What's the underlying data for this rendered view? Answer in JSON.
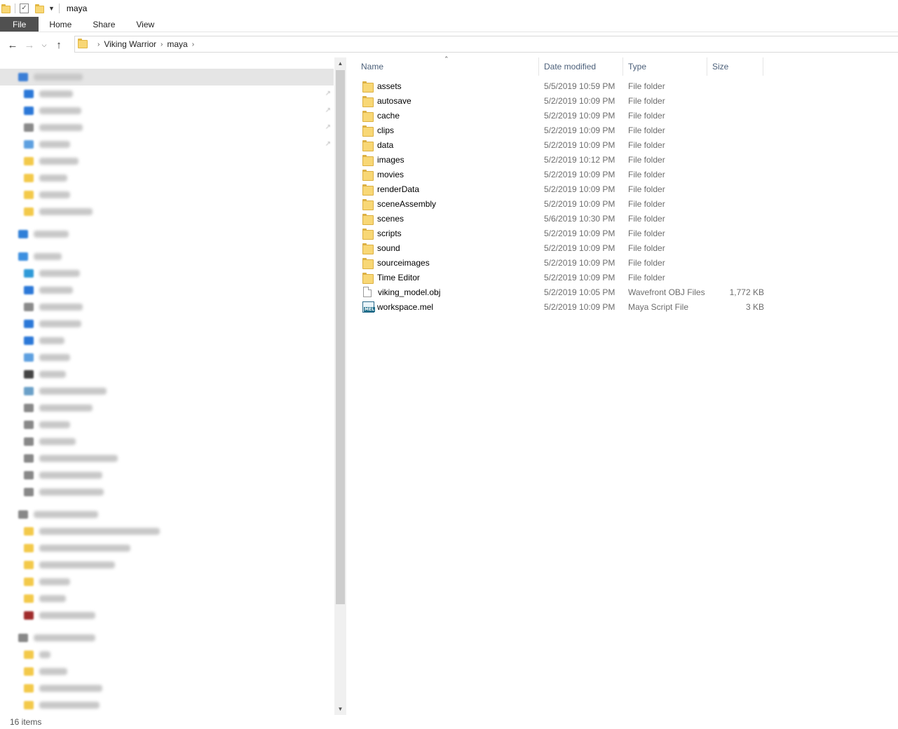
{
  "window": {
    "title": "maya"
  },
  "ribbon": {
    "tabs": [
      "File",
      "Home",
      "Share",
      "View"
    ]
  },
  "address": {
    "crumbs": [
      "Viking Warrior",
      "maya"
    ]
  },
  "nav_pane": {
    "items": [
      {
        "icon": "star-icon",
        "color": "#3a7dd6",
        "width": 70,
        "selected": true,
        "indent": 0
      },
      {
        "icon": "desktop-icon",
        "color": "#2b78d8",
        "width": 48,
        "pinned": true,
        "indent": 1
      },
      {
        "icon": "download-icon",
        "color": "#2b78d8",
        "width": 60,
        "pinned": true,
        "indent": 1
      },
      {
        "icon": "document-icon",
        "color": "#8a8a8a",
        "width": 62,
        "pinned": true,
        "indent": 1
      },
      {
        "icon": "pictures-icon",
        "color": "#5ea0e0",
        "width": 44,
        "pinned": true,
        "indent": 1
      },
      {
        "icon": "folder-icon",
        "color": "#f3c94a",
        "width": 56,
        "indent": 1
      },
      {
        "icon": "folder-icon",
        "color": "#f3c94a",
        "width": 40,
        "indent": 1
      },
      {
        "icon": "folder-icon",
        "color": "#f3c94a",
        "width": 44,
        "indent": 1
      },
      {
        "icon": "folder-icon",
        "color": "#f3c94a",
        "width": 76,
        "indent": 1
      },
      {
        "icon": "onedrive-icon",
        "color": "#2f7fd8",
        "width": 50,
        "indent": 0,
        "gap": true
      },
      {
        "icon": "pc-icon",
        "color": "#3c8fe0",
        "width": 40,
        "indent": 0,
        "gap": true
      },
      {
        "icon": "cube-icon",
        "color": "#2f9ad8",
        "width": 58,
        "indent": 1
      },
      {
        "icon": "desktop-icon",
        "color": "#2b78d8",
        "width": 48,
        "indent": 1
      },
      {
        "icon": "document-icon",
        "color": "#8a8a8a",
        "width": 62,
        "indent": 1
      },
      {
        "icon": "download-icon",
        "color": "#2b78d8",
        "width": 60,
        "indent": 1
      },
      {
        "icon": "music-icon",
        "color": "#2b78d8",
        "width": 36,
        "indent": 1
      },
      {
        "icon": "pictures-icon",
        "color": "#5ea0e0",
        "width": 44,
        "indent": 1
      },
      {
        "icon": "video-icon",
        "color": "#444444",
        "width": 38,
        "indent": 1
      },
      {
        "icon": "drive-icon",
        "color": "#6aa0c8",
        "width": 96,
        "indent": 1
      },
      {
        "icon": "drive-icon",
        "color": "#888888",
        "width": 76,
        "indent": 1
      },
      {
        "icon": "drive-icon",
        "color": "#888888",
        "width": 44,
        "indent": 1
      },
      {
        "icon": "drive-icon",
        "color": "#888888",
        "width": 52,
        "indent": 1
      },
      {
        "icon": "drive-icon",
        "color": "#888888",
        "width": 112,
        "indent": 1
      },
      {
        "icon": "drive-icon",
        "color": "#888888",
        "width": 90,
        "indent": 1
      },
      {
        "icon": "drive-icon",
        "color": "#888888",
        "width": 92,
        "indent": 1
      },
      {
        "icon": "drive-icon",
        "color": "#888888",
        "width": 92,
        "indent": 0,
        "gap": true
      },
      {
        "icon": "folder-icon",
        "color": "#f3c94a",
        "width": 172,
        "indent": 1
      },
      {
        "icon": "folder-icon",
        "color": "#f3c94a",
        "width": 130,
        "indent": 1
      },
      {
        "icon": "folder-icon",
        "color": "#f3c94a",
        "width": 108,
        "indent": 1
      },
      {
        "icon": "folder-icon",
        "color": "#f3c94a",
        "width": 44,
        "indent": 1
      },
      {
        "icon": "folder-icon",
        "color": "#f3c94a",
        "width": 38,
        "indent": 1
      },
      {
        "icon": "archive-icon",
        "color": "#a02c2c",
        "width": 80,
        "indent": 1
      },
      {
        "icon": "drive-icon",
        "color": "#888888",
        "width": 88,
        "indent": 0,
        "gap": true
      },
      {
        "icon": "folder-icon",
        "color": "#f3c94a",
        "width": 16,
        "indent": 1
      },
      {
        "icon": "folder-icon",
        "color": "#f3c94a",
        "width": 40,
        "indent": 1
      },
      {
        "icon": "folder-icon",
        "color": "#f3c94a",
        "width": 90,
        "indent": 1
      },
      {
        "icon": "folder-icon",
        "color": "#f3c94a",
        "width": 86,
        "indent": 1
      }
    ]
  },
  "file_list": {
    "columns": {
      "name": "Name",
      "date": "Date modified",
      "type": "Type",
      "size": "Size"
    },
    "rows": [
      {
        "icon": "folder-icon",
        "name": "assets",
        "date": "5/5/2019 10:59 PM",
        "type": "File folder",
        "size": ""
      },
      {
        "icon": "folder-icon",
        "name": "autosave",
        "date": "5/2/2019 10:09 PM",
        "type": "File folder",
        "size": ""
      },
      {
        "icon": "folder-icon",
        "name": "cache",
        "date": "5/2/2019 10:09 PM",
        "type": "File folder",
        "size": ""
      },
      {
        "icon": "folder-icon",
        "name": "clips",
        "date": "5/2/2019 10:09 PM",
        "type": "File folder",
        "size": ""
      },
      {
        "icon": "folder-icon",
        "name": "data",
        "date": "5/2/2019 10:09 PM",
        "type": "File folder",
        "size": ""
      },
      {
        "icon": "folder-icon",
        "name": "images",
        "date": "5/2/2019 10:12 PM",
        "type": "File folder",
        "size": ""
      },
      {
        "icon": "folder-icon",
        "name": "movies",
        "date": "5/2/2019 10:09 PM",
        "type": "File folder",
        "size": ""
      },
      {
        "icon": "folder-icon",
        "name": "renderData",
        "date": "5/2/2019 10:09 PM",
        "type": "File folder",
        "size": ""
      },
      {
        "icon": "folder-icon",
        "name": "sceneAssembly",
        "date": "5/2/2019 10:09 PM",
        "type": "File folder",
        "size": ""
      },
      {
        "icon": "folder-icon",
        "name": "scenes",
        "date": "5/6/2019 10:30 PM",
        "type": "File folder",
        "size": ""
      },
      {
        "icon": "folder-icon",
        "name": "scripts",
        "date": "5/2/2019 10:09 PM",
        "type": "File folder",
        "size": ""
      },
      {
        "icon": "folder-icon",
        "name": "sound",
        "date": "5/2/2019 10:09 PM",
        "type": "File folder",
        "size": ""
      },
      {
        "icon": "folder-icon",
        "name": "sourceimages",
        "date": "5/2/2019 10:09 PM",
        "type": "File folder",
        "size": ""
      },
      {
        "icon": "folder-icon",
        "name": "Time Editor",
        "date": "5/2/2019 10:09 PM",
        "type": "File folder",
        "size": ""
      },
      {
        "icon": "file-icon",
        "name": "viking_model.obj",
        "date": "5/2/2019 10:05 PM",
        "type": "Wavefront OBJ Files",
        "size": "1,772 KB"
      },
      {
        "icon": "mel-script-icon",
        "name": "workspace.mel",
        "date": "5/2/2019 10:09 PM",
        "type": "Maya Script File",
        "size": "3 KB"
      }
    ]
  },
  "status": {
    "item_count": "16 items"
  }
}
